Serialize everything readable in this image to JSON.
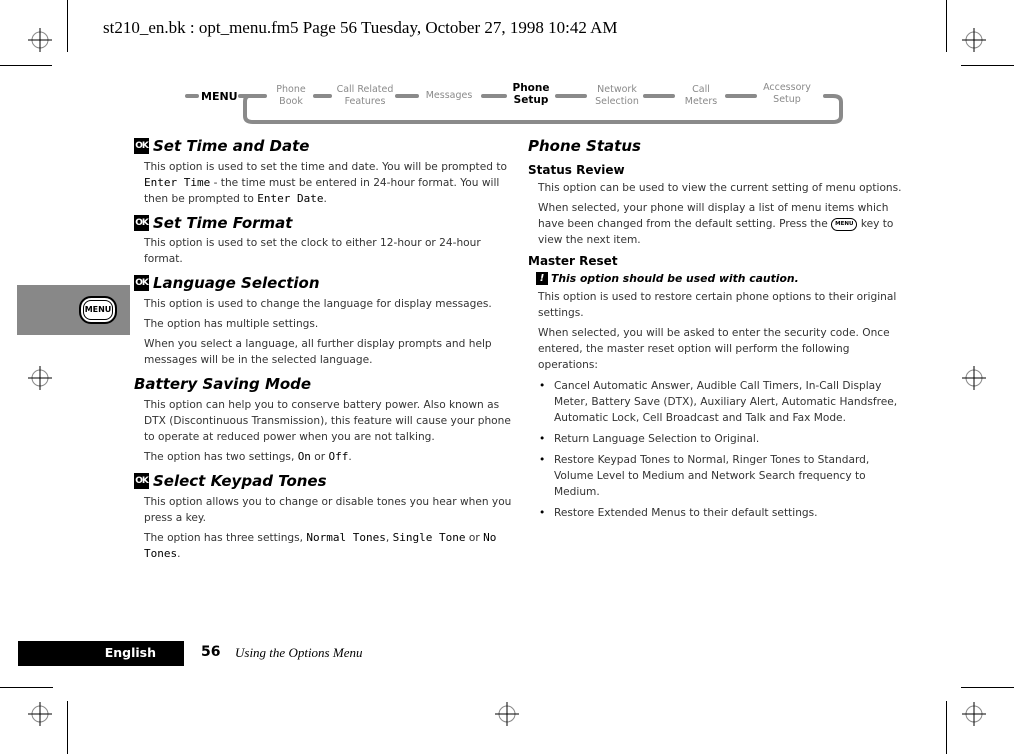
{
  "header": {
    "print_slug": "st210_en.bk : opt_menu.fm5  Page 56  Tuesday, October 27, 1998  10:42 AM"
  },
  "menu_diagram": {
    "root": "MENU",
    "items": [
      {
        "line1": "Phone",
        "line2": "Book",
        "active": false
      },
      {
        "line1": "Call Related",
        "line2": "Features",
        "active": false
      },
      {
        "line1": "Messages",
        "line2": "",
        "active": false
      },
      {
        "line1": "Phone",
        "line2": "Setup",
        "active": true
      },
      {
        "line1": "Network",
        "line2": "Selection",
        "active": false
      },
      {
        "line1": "Call",
        "line2": "Meters",
        "active": false
      },
      {
        "line1": "Accessory",
        "line2": "Setup",
        "active": false
      }
    ]
  },
  "side_tab": {
    "key_label": "MENU",
    "color": "#888888"
  },
  "left_column": {
    "set_time_date": {
      "icon": "OK",
      "title": "Set Time and Date",
      "p1_a": "This option is used to set the time and date. You will be prompted to ",
      "p1_code1": "Enter Time",
      "p1_b": " - the time must be entered in 24-hour format. You will then be prompted to ",
      "p1_code2": "Enter Date",
      "p1_c": "."
    },
    "set_time_format": {
      "icon": "OK",
      "title": "Set Time Format",
      "p1": "This option is used to set the clock to either 12-hour or 24-hour format."
    },
    "language_selection": {
      "icon": "OK",
      "title": "Language Selection",
      "p1": "This option is used to change the language for display messages.",
      "p2": "The option has multiple settings.",
      "p3": "When you select a language, all further display prompts and help messages will be in the selected language."
    },
    "battery_saving": {
      "title": "Battery Saving Mode",
      "p1": "This option can help you to conserve battery power. Also known as DTX (Discontinuous Transmission), this feature will cause your phone to operate at reduced power when you are not talking.",
      "p2_a": "The option has two settings, ",
      "p2_code1": "On",
      "p2_b": " or ",
      "p2_code2": "Off",
      "p2_c": "."
    },
    "keypad_tones": {
      "icon": "OK",
      "title": "Select Keypad Tones",
      "p1": "This option allows you to change or disable tones you hear when you press a key.",
      "p2_a": "The option has three settings, ",
      "p2_code1": "Normal Tones",
      "p2_b": ", ",
      "p2_code2": "Single Tone",
      "p2_c": " or ",
      "p2_code3": "No Tones",
      "p2_d": "."
    }
  },
  "right_column": {
    "phone_status": {
      "title": "Phone Status",
      "status_review": {
        "title": "Status Review",
        "p1": "This option can be used to view the current setting of menu options.",
        "p2": "When selected, your phone will display a list of menu items which have been changed from the default setting. Press the",
        "p2_key": "MENU",
        "p2_b": " key to view the next item."
      },
      "master_reset": {
        "title": "Master Reset",
        "caution_icon": "!",
        "caution": "This option should be used with caution.",
        "p1": "This option is used to restore certain phone options to their original settings.",
        "p2": "When selected, you will be asked to enter the security code. Once entered, the master reset option will perform the following operations:",
        "bullets": [
          "Cancel Automatic Answer, Audible Call Timers, In-Call Display Meter, Battery Save (DTX), Auxiliary Alert, Automatic Handsfree, Automatic Lock, Cell Broadcast and Talk and Fax Mode.",
          "Return Language Selection to Original.",
          "Restore Keypad Tones to Normal, Ringer Tones to Standard, Volume Level to Medium and Network Search frequency to Medium.",
          "Restore Extended Menus to their default settings."
        ]
      }
    }
  },
  "footer": {
    "language": "English",
    "page_number": "56",
    "section_title": "Using the Options Menu"
  }
}
